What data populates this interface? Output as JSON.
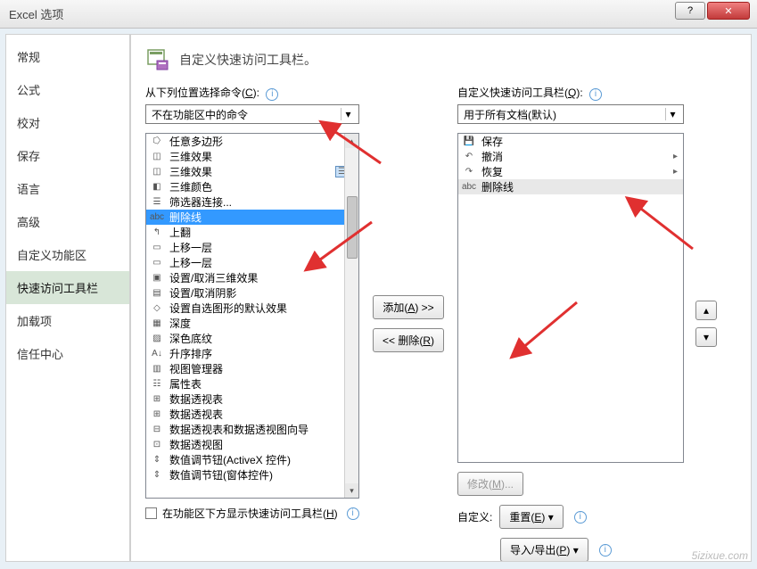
{
  "window": {
    "title": "Excel 选项"
  },
  "sidebar": {
    "items": [
      "常规",
      "公式",
      "校对",
      "保存",
      "语言",
      "高级",
      "自定义功能区",
      "快速访问工具栏",
      "加载项",
      "信任中心"
    ],
    "selected_index": 7
  },
  "header": {
    "title": "自定义快速访问工具栏。"
  },
  "left": {
    "label_prefix": "从下列位置选择命令(",
    "label_accel": "C",
    "label_suffix": "):",
    "dropdown": "不在功能区中的命令",
    "items": [
      {
        "icon": "freeform-icon",
        "label": "任意多边形",
        "expand": true
      },
      {
        "icon": "3d-effects-icon",
        "label": "三维效果",
        "expand": true
      },
      {
        "icon": "3d-effects-icon",
        "label": "三维效果",
        "submenu": true
      },
      {
        "icon": "3d-color-icon",
        "label": "三维颜色",
        "expand": true
      },
      {
        "icon": "slicer-connect-icon",
        "label": "筛选器连接..."
      },
      {
        "icon": "strikethrough-icon",
        "label": "删除线",
        "selected": true
      },
      {
        "icon": "up-level-icon",
        "label": "上翻"
      },
      {
        "icon": "bring-forward-icon",
        "label": "上移一层",
        "expand": true
      },
      {
        "icon": "bring-forward-icon",
        "label": "上移一层"
      },
      {
        "icon": "3d-toggle-icon",
        "label": "设置/取消三维效果"
      },
      {
        "icon": "shadow-toggle-icon",
        "label": "设置/取消阴影"
      },
      {
        "icon": "autoshape-defaults-icon",
        "label": "设置自选图形的默认效果"
      },
      {
        "icon": "depth-icon",
        "label": "深度",
        "expand": true
      },
      {
        "icon": "dark-pattern-icon",
        "label": "深色底纹"
      },
      {
        "icon": "sort-asc-icon",
        "label": "升序排序"
      },
      {
        "icon": "view-manager-icon",
        "label": "视图管理器"
      },
      {
        "icon": "property-sheet-icon",
        "label": "属性表"
      },
      {
        "icon": "pivot-table-icon",
        "label": "数据透视表",
        "expand": true
      },
      {
        "icon": "pivot-table-icon",
        "label": "数据透视表"
      },
      {
        "icon": "pivot-wizard-icon",
        "label": "数据透视表和数据透视图向导"
      },
      {
        "icon": "pivot-chart-icon",
        "label": "数据透视图"
      },
      {
        "icon": "spinner-activex-icon",
        "label": "数值调节钮(ActiveX 控件)"
      },
      {
        "icon": "spinner-form-icon",
        "label": "数值调节钮(窗体控件)"
      }
    ],
    "checkbox_label_prefix": "在功能区下方显示快速访问工具栏(",
    "checkbox_accel": "H",
    "checkbox_suffix": ")"
  },
  "mid": {
    "add_prefix": "添加(",
    "add_accel": "A",
    "add_suffix": ") >>",
    "remove_prefix": "<< 删除(",
    "remove_accel": "R",
    "remove_suffix": ")"
  },
  "right": {
    "label_prefix": "自定义快速访问工具栏(",
    "label_accel": "Q",
    "label_suffix": "):",
    "dropdown": "用于所有文档(默认)",
    "items": [
      {
        "icon": "save-icon",
        "label": "保存"
      },
      {
        "icon": "undo-icon",
        "label": "撤消",
        "expand": true
      },
      {
        "icon": "redo-icon",
        "label": "恢复",
        "expand": true
      },
      {
        "icon": "strikethrough-icon",
        "label": "删除线",
        "highlight": true
      }
    ],
    "modify_prefix": "修改(",
    "modify_accel": "M",
    "modify_suffix": ")...",
    "customize_label": "自定义:",
    "reset_prefix": "重置(",
    "reset_accel": "E",
    "reset_suffix": ") ▾",
    "import_export_prefix": "导入/导出(",
    "import_export_accel": "P",
    "import_export_suffix": ") ▾"
  },
  "watermark": "5izixue.com"
}
